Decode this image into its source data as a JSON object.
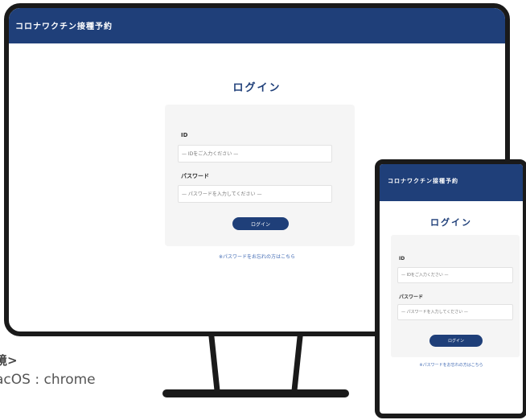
{
  "desktop": {
    "header_title": "コロナワクチン接種予約",
    "page_title": "ログイン",
    "id_label": "ID",
    "id_placeholder": "— IDをご入力ください —",
    "password_label": "パスワード",
    "password_placeholder": "— パスワードを入力してください —",
    "login_button": "ログイン",
    "forgot_link": "※パスワードをお忘れの方はこちら"
  },
  "tablet": {
    "header_title": "コロナワクチン接種予約",
    "page_title": "ログイン",
    "id_label": "ID",
    "id_placeholder": "— IDをご入力ください —",
    "password_label": "パスワード",
    "password_placeholder": "— パスワードを入力してください —",
    "login_button": "ログイン",
    "forgot_link": "※パスワードをお忘れの方はこちら"
  },
  "environment": {
    "heading": "境>",
    "line": "acOS : chrome"
  },
  "colors": {
    "brand": "#1f3f79",
    "link": "#3f69b3",
    "card": "#f5f5f5",
    "bezel": "#1a1a1a"
  }
}
